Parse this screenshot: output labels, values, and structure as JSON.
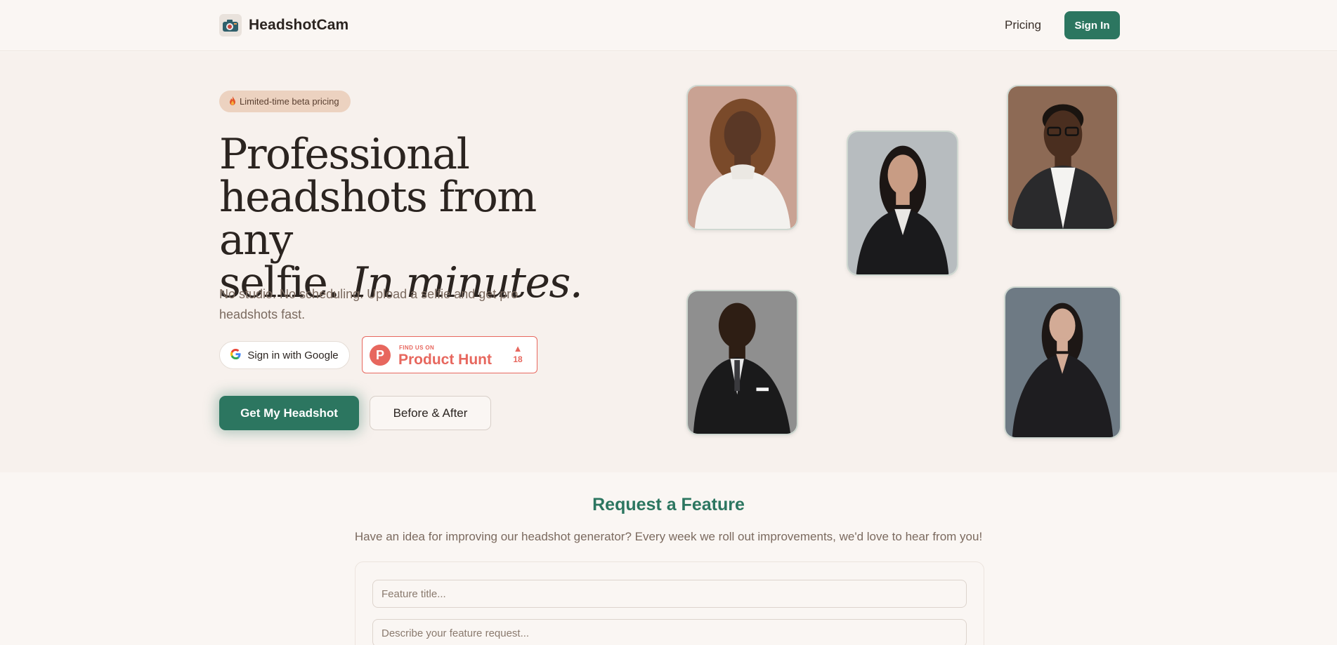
{
  "header": {
    "brand": "HeadshotCam",
    "nav_pricing": "Pricing",
    "signin_label": "Sign In"
  },
  "hero": {
    "badge_icon": "fire-icon",
    "badge_text": "Limited-time beta pricing",
    "title_line1": "Professional",
    "title_line2": "headshots from any",
    "title_line3a": "selfie.",
    "title_line3b": "In minutes.",
    "subtitle": "No studio. No scheduling. Upload a selfie and get pro headshots fast.",
    "google_button": "Sign in with Google",
    "product_hunt": {
      "small": "FIND US ON",
      "big": "Product Hunt",
      "votes": "18"
    },
    "cta_primary": "Get My Headshot",
    "cta_secondary": "Before & After"
  },
  "feature_request": {
    "title": "Request a Feature",
    "subtitle": "Have an idea for improving our headshot generator? Every week we roll out improvements, we'd love to hear from you!",
    "title_placeholder": "Feature title...",
    "description_placeholder": "Describe your feature request..."
  },
  "colors": {
    "accent": "#2c7660",
    "product_hunt": "#e7675e",
    "badge_bg": "#ecd2c0"
  }
}
